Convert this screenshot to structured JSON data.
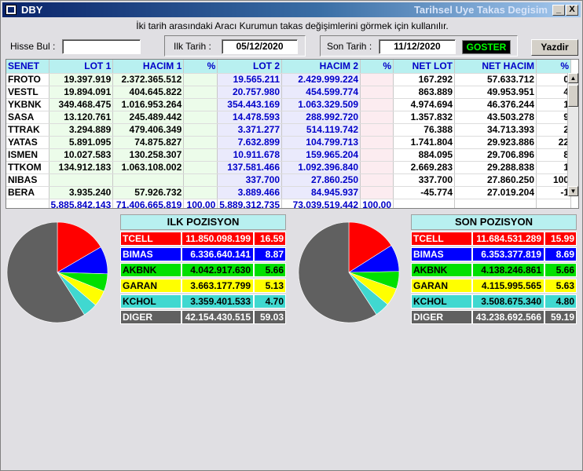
{
  "window": {
    "title": "DBY",
    "subtitle": "Tarihsel Uye Takas Degisim",
    "min_label": "_",
    "close_label": "X"
  },
  "info_text": "İki tarih arasındaki  Aracı Kurumun takas değişimlerini görmek için kullanılır.",
  "filters": {
    "hisse_label": "Hisse Bul :",
    "hisse_value": "",
    "ilk_label": "Ilk Tarih :",
    "ilk_value": "05/12/2020",
    "son_label": "Son Tarih :",
    "son_value": "11/12/2020",
    "goster_label": "GOSTER",
    "yazdir_label": "Yazdir"
  },
  "table": {
    "headers": [
      "SENET",
      "LOT 1",
      "HACIM 1",
      "%",
      "LOT 2",
      "HACIM 2",
      "%",
      "NET LOT",
      "NET HACIM",
      "%"
    ],
    "rows": [
      [
        "FROTO",
        "19.397.919",
        "2.372.365.512",
        "",
        "19.565.211",
        "2.429.999.224",
        "",
        "167.292",
        "57.633.712",
        "0"
      ],
      [
        "VESTL",
        "19.894.091",
        "404.645.822",
        "",
        "20.757.980",
        "454.599.774",
        "",
        "863.889",
        "49.953.951",
        "4"
      ],
      [
        "YKBNK",
        "349.468.475",
        "1.016.953.264",
        "",
        "354.443.169",
        "1.063.329.509",
        "",
        "4.974.694",
        "46.376.244",
        "1"
      ],
      [
        "SASA",
        "13.120.761",
        "245.489.442",
        "",
        "14.478.593",
        "288.992.720",
        "",
        "1.357.832",
        "43.503.278",
        "9"
      ],
      [
        "TTRAK",
        "3.294.889",
        "479.406.349",
        "",
        "3.371.277",
        "514.119.742",
        "",
        "76.388",
        "34.713.393",
        "2"
      ],
      [
        "YATAS",
        "5.891.095",
        "74.875.827",
        "",
        "7.632.899",
        "104.799.713",
        "",
        "1.741.804",
        "29.923.886",
        "22"
      ],
      [
        "ISMEN",
        "10.027.583",
        "130.258.307",
        "",
        "10.911.678",
        "159.965.204",
        "",
        "884.095",
        "29.706.896",
        "8"
      ],
      [
        "TTKOM",
        "134.912.183",
        "1.063.108.002",
        "",
        "137.581.466",
        "1.092.396.840",
        "",
        "2.669.283",
        "29.288.838",
        "1"
      ],
      [
        "NIBAS",
        "",
        "",
        "",
        "337.700",
        "27.860.250",
        "",
        "337.700",
        "27.860.250",
        "100"
      ],
      [
        "BERA",
        "3.935.240",
        "57.926.732",
        "",
        "3.889.466",
        "84.945.937",
        "",
        "-45.774",
        "27.019.204",
        "-1"
      ]
    ],
    "totals": [
      "",
      "5.885.842.143",
      "71.406.665.819",
      "100,00",
      "5.889.312.735",
      "73.039.519.442",
      "100,00",
      "",
      "",
      ""
    ]
  },
  "ilk": {
    "title": "ILK POZISYON",
    "rows": [
      {
        "name": "TCELL",
        "value": "11.850.098.199",
        "pct": "16.59",
        "color": "#ff0000"
      },
      {
        "name": "BIMAS",
        "value": "6.336.640.141",
        "pct": "8.87",
        "color": "#0000ff"
      },
      {
        "name": "AKBNK",
        "value": "4.042.917.630",
        "pct": "5.66",
        "color": "#00e000"
      },
      {
        "name": "GARAN",
        "value": "3.663.177.799",
        "pct": "5.13",
        "color": "#ffff00"
      },
      {
        "name": "KCHOL",
        "value": "3.359.401.533",
        "pct": "4.70",
        "color": "#40d8d0"
      },
      {
        "name": "DIGER",
        "value": "42.154.430.515",
        "pct": "59.03",
        "color": "#606060"
      }
    ]
  },
  "son": {
    "title": "SON POZISYON",
    "rows": [
      {
        "name": "TCELL",
        "value": "11.684.531.289",
        "pct": "15.99",
        "color": "#ff0000"
      },
      {
        "name": "BIMAS",
        "value": "6.353.377.819",
        "pct": "8.69",
        "color": "#0000ff"
      },
      {
        "name": "AKBNK",
        "value": "4.138.246.861",
        "pct": "5.66",
        "color": "#00e000"
      },
      {
        "name": "GARAN",
        "value": "4.115.995.565",
        "pct": "5.63",
        "color": "#ffff00"
      },
      {
        "name": "KCHOL",
        "value": "3.508.675.340",
        "pct": "4.80",
        "color": "#40d8d0"
      },
      {
        "name": "DIGER",
        "value": "43.238.692.566",
        "pct": "59.19",
        "color": "#606060"
      }
    ]
  }
}
